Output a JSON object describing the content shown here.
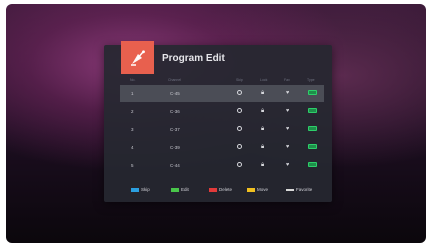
{
  "dialog": {
    "title": "Program Edit",
    "icon": "satellite-dish-icon",
    "accent_color": "#e8604e"
  },
  "columns": [
    "No.",
    "Channel",
    "Skip",
    "Lock",
    "Fav",
    "Type"
  ],
  "rows": [
    {
      "num": "1",
      "name": "C-45",
      "selected": true
    },
    {
      "num": "2",
      "name": "C-36",
      "selected": false
    },
    {
      "num": "3",
      "name": "C-37",
      "selected": false
    },
    {
      "num": "4",
      "name": "C-39",
      "selected": false
    },
    {
      "num": "5",
      "name": "C-44",
      "selected": false
    }
  ],
  "legend": [
    {
      "label": "Skip",
      "color": "#2b9fe0"
    },
    {
      "label": "Edit",
      "color": "#49c64a"
    },
    {
      "label": "Delete",
      "color": "#e23a3a"
    },
    {
      "label": "Move",
      "color": "#f0c020"
    },
    {
      "label": "Favorite",
      "color": "#d8d8d8"
    }
  ]
}
